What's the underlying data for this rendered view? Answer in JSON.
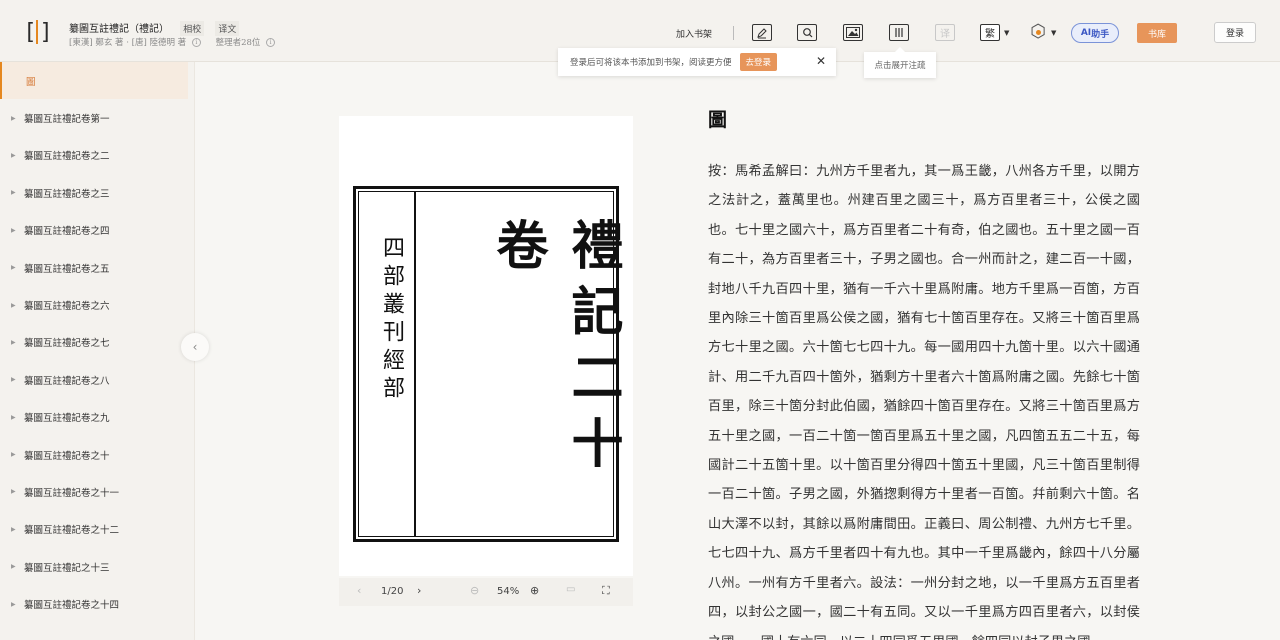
{
  "header": {
    "book_title": "纂圖互註禮記（禮記）",
    "tags": [
      "相校",
      "译文"
    ],
    "authors": "[東漢] 鄭玄 著 · [唐] 陸德明 著",
    "editors": "整理者28位",
    "add_to_shelf": "加入书架",
    "toolbar": {
      "annotate_icon": "pen-square-icon",
      "search_icon": "search-icon",
      "image_icon": "image-icon",
      "columns_icon": "columns-icon",
      "translate_label": "译",
      "traditional_label": "繁",
      "ai_label": "助手",
      "ai_prefix": "AI",
      "library_label": "书库",
      "login_label": "登录"
    }
  },
  "toast": {
    "message": "登录后可将该本书添加到书架，阅读更方便",
    "action": "去登录",
    "close": "✕"
  },
  "tooltip": "点击展开注疏",
  "sidebar": {
    "items": [
      {
        "label": "圖",
        "active": true
      },
      {
        "label": "纂圖互註禮記卷第一"
      },
      {
        "label": "纂圖互註禮記卷之二"
      },
      {
        "label": "纂圖互註禮記卷之三"
      },
      {
        "label": "纂圖互註禮記卷之四"
      },
      {
        "label": "纂圖互註禮記卷之五"
      },
      {
        "label": "纂圖互註禮記卷之六"
      },
      {
        "label": "纂圖互註禮記卷之七"
      },
      {
        "label": "纂圖互註禮記卷之八"
      },
      {
        "label": "纂圖互註禮記卷之九"
      },
      {
        "label": "纂圖互註禮記卷之十"
      },
      {
        "label": "纂圖互註禮記卷之十一"
      },
      {
        "label": "纂圖互註禮記卷之十二"
      },
      {
        "label": "纂圖互註禮記之十三"
      },
      {
        "label": "纂圖互註禮記卷之十四"
      }
    ]
  },
  "viewer": {
    "scan_small": "四部叢刊經部",
    "scan_big": "禮記二十卷",
    "page": "1/20",
    "zoom": "54%"
  },
  "content": {
    "title": "圖",
    "text": "按：馬希孟解曰：九州方千里者九，其一爲王畿，八州各方千里，以開方之法計之，蓋萬里也。州建百里之國三十，爲方百里者三十，公侯之國也。七十里之國六十，爲方百里者二十有奇，伯之國也。五十里之國一百有二十，為方百里者三十，子男之國也。合一州而計之，建二百一十國，封地八千九百四十里，猶有一千六十里爲附庸。地方千里爲一百箇，方百里內除三十箇百里爲公侯之國，猶有七十箇百里存在。又將三十箇百里爲方七十里之國。六十箇七七四十九。每一國用四十九箇十里。以六十國通計、用二千九百四十箇外，猶剩方十里者六十箇爲附庸之國。先餘七十箇百里，除三十箇分封此伯國，猶餘四十箇百里存在。又將三十箇百里爲方五十里之國，一百二十箇一箇百里爲五十里之國，凡四箇五五二十五，每國計二十五箇十里。以十箇百里分得四十箇五十里國，凡三十箇百里制得一百二十箇。子男之國，外猶揔剩得方十里者一百箇。幷前剩六十箇。名山大澤不以封，其餘以爲附庸間田。正義曰、周公制禮、九州方七千里。七七四十九、爲方千里者四十有九也。其中一千里爲畿內，餘四十八分屬八州。一州有方千里者六。設法：一州分封之地，以一千里爲方五百里者四，以封公之國一，國二十有五同。又以一千里爲方四百里者六，以封侯之國一，國十有六同，以二十四同爲五里國，餘四同以封子男之國"
  }
}
